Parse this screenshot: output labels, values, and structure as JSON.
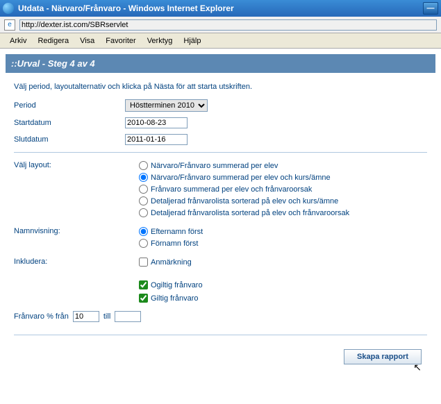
{
  "titlebar": {
    "title": "Utdata - Närvaro/Frånvaro - Windows Internet Explorer"
  },
  "address": {
    "url": "http://dexter.ist.com/SBRservlet"
  },
  "menubar": {
    "arkiv": "Arkiv",
    "redigera": "Redigera",
    "visa": "Visa",
    "favoriter": "Favoriter",
    "verktyg": "Verktyg",
    "hj": "Hjälp"
  },
  "panel": {
    "title": "::Urval - Steg 4 av 4",
    "instr": "Välj period, layoutalternativ och klicka på Nästa för att starta utskriften."
  },
  "labels": {
    "period": "Period",
    "startdatum": "Startdatum",
    "slutdatum": "Slutdatum",
    "valj_layout": "Välj layout:",
    "namnvisning": "Namnvisning:",
    "inkludera": "Inkludera:",
    "franvaro_pct": "Frånvaro % från",
    "till": "till"
  },
  "values": {
    "period_selected": "Höstterminen 2010",
    "start": "2010-08-23",
    "slut": "2011-01-16",
    "franvaro_from": "10",
    "franvaro_to": ""
  },
  "layout_radios": {
    "r1": "Närvaro/Frånvaro summerad per elev",
    "r2": "Närvaro/Frånvaro summerad per elev och kurs/ämne",
    "r3": "Frånvaro summerad per elev och frånvaroorsak",
    "r4": "Detaljerad frånvarolista sorterad på elev och kurs/ämne",
    "r5": "Detaljerad frånvarolista sorterad på elev och frånvaroorsak"
  },
  "namn_radios": {
    "e": "Efternamn först",
    "f": "Förnamn först"
  },
  "checks": {
    "anm": "Anmärkning",
    "ogiltig": "Ogiltig frånvaro",
    "giltig": "Giltig frånvaro"
  },
  "buttons": {
    "skapa": "Skapa rapport"
  }
}
